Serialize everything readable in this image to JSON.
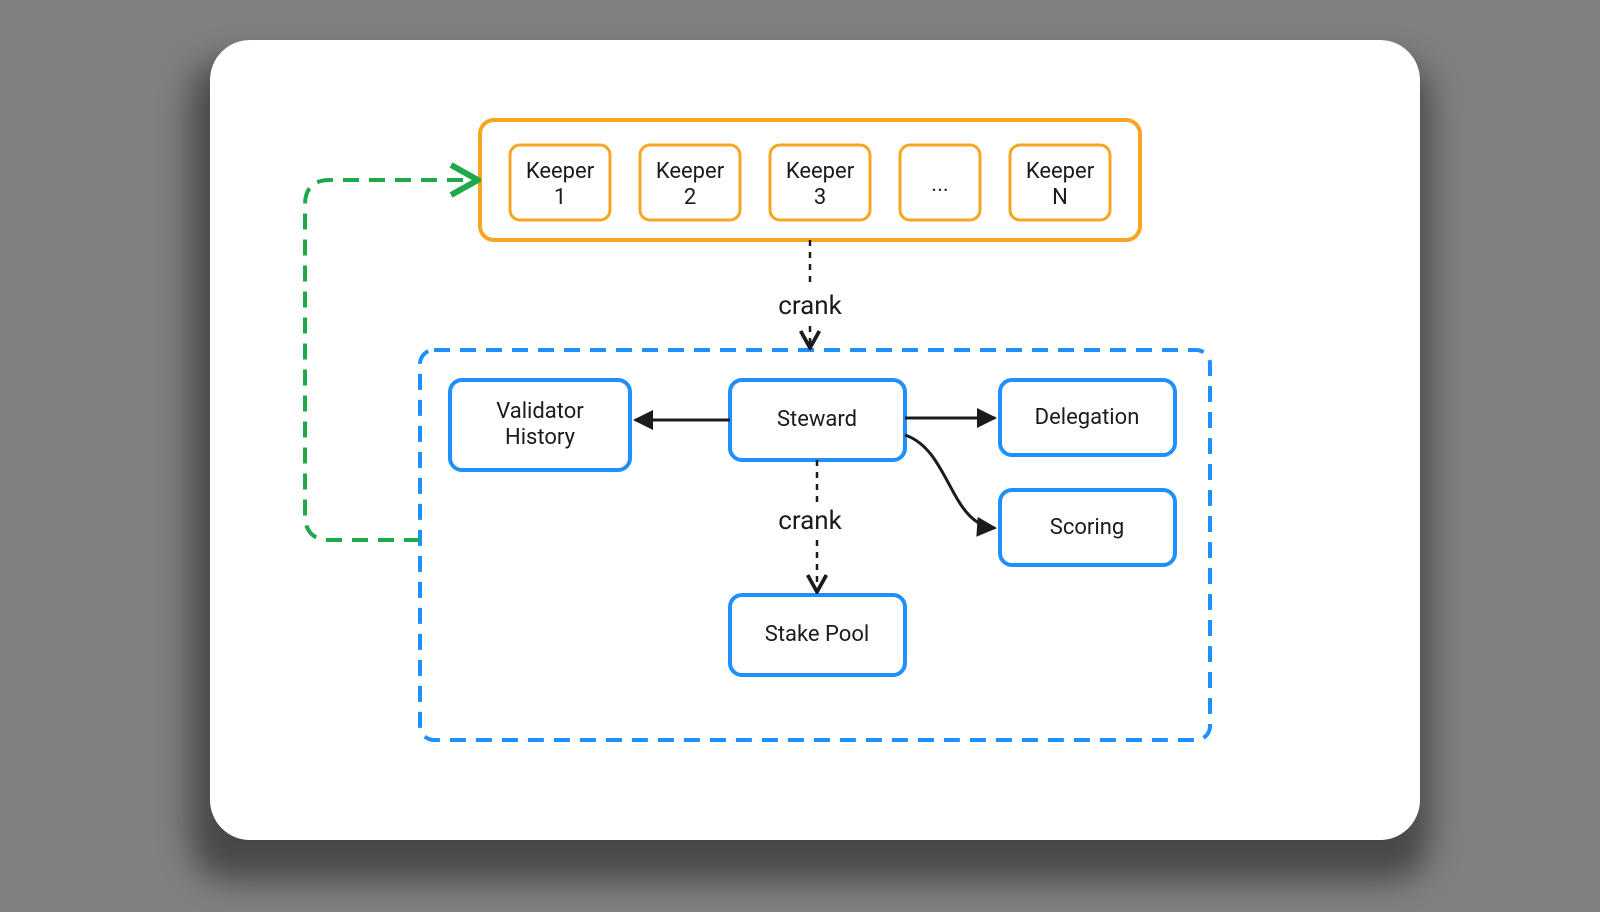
{
  "keepers": {
    "items": [
      "Keeper 1",
      "Keeper 2",
      "Keeper 3",
      "...",
      "Keeper N"
    ]
  },
  "labels": {
    "crank_top": "crank",
    "crank_bottom": "crank"
  },
  "nodes": {
    "validator_history": "Validator History",
    "steward": "Steward",
    "delegation": "Delegation",
    "scoring": "Scoring",
    "stake_pool": "Stake Pool"
  },
  "colors": {
    "orange": "#f5a623",
    "blue": "#1e90ff",
    "green": "#1fa84a",
    "ink": "#1b1b1b"
  }
}
